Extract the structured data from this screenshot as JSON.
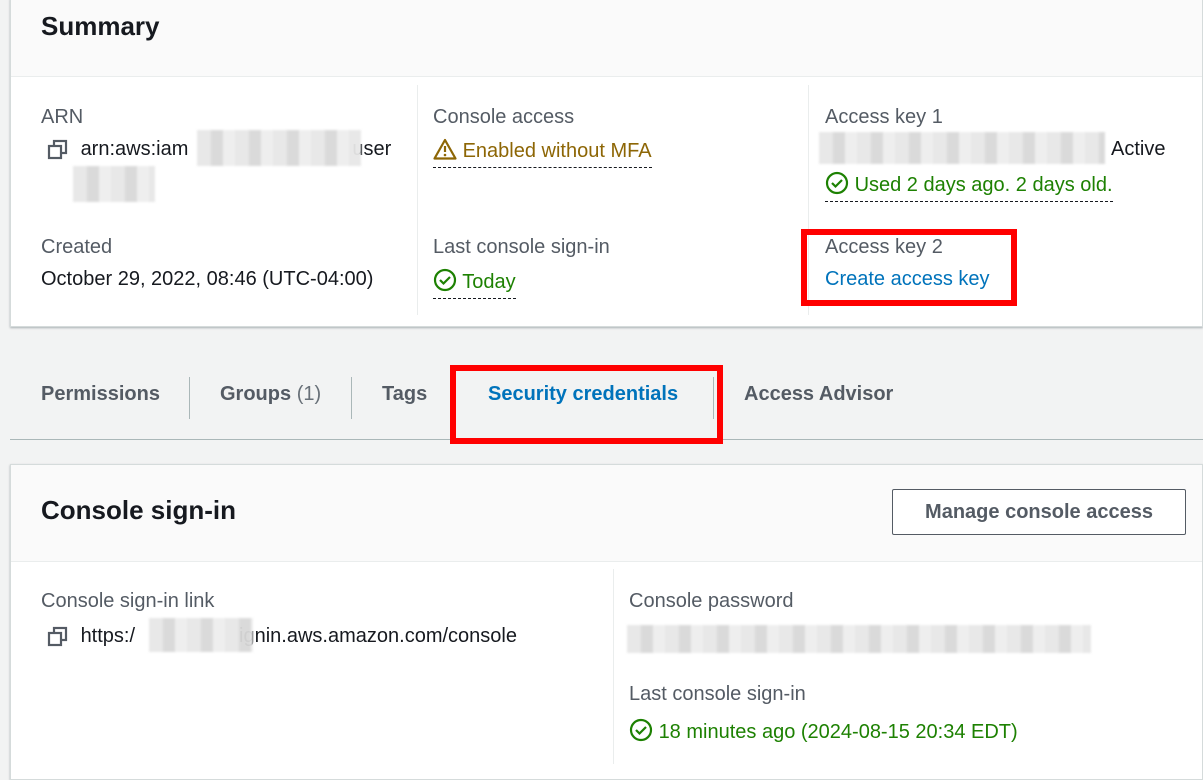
{
  "summary": {
    "title": "Summary",
    "arn_label": "ARN",
    "arn_prefix": "arn:aws:iam",
    "arn_suffix": "user",
    "created_label": "Created",
    "created_value": "October 29, 2022, 08:46 (UTC-04:00)",
    "console_access_label": "Console access",
    "console_access_value": "Enabled without MFA",
    "last_signin_label": "Last console sign-in",
    "last_signin_value": "Today",
    "access_key1_label": "Access key 1",
    "access_key1_status": "Active",
    "access_key1_usage": "Used 2 days ago. 2 days old.",
    "access_key2_label": "Access key 2",
    "create_access_key": "Create access key"
  },
  "tabs": [
    {
      "label": "Permissions"
    },
    {
      "label": "Groups",
      "count": "(1)"
    },
    {
      "label": "Tags"
    },
    {
      "label": "Security credentials",
      "active": true
    },
    {
      "label": "Access Advisor"
    }
  ],
  "console_signin": {
    "title": "Console sign-in",
    "manage_button": "Manage console access",
    "link_label": "Console sign-in link",
    "link_prefix": "https:/",
    "link_suffix": "ignin.aws.amazon.com/console",
    "password_label": "Console password",
    "last_signin_label": "Last console sign-in",
    "last_signin_value": "18 minutes ago (2024-08-15 20:34 EDT)"
  },
  "colors": {
    "accent": "#0073bb",
    "success": "#1d8102",
    "warning": "#8d6605",
    "highlight": "#ff0000"
  },
  "icons": [
    "copy-icon",
    "warning-icon",
    "check-circle-icon"
  ]
}
